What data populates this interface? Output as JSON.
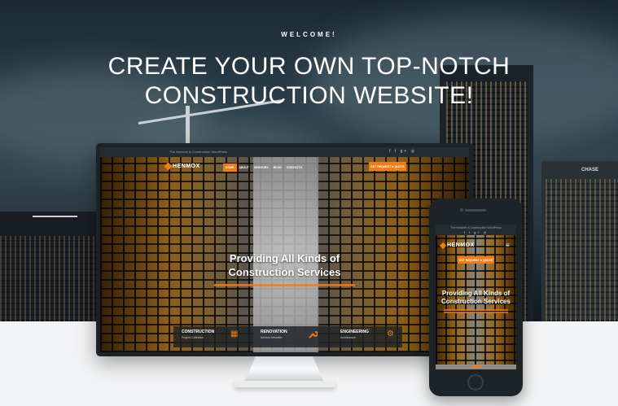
{
  "hero": {
    "welcome": "WELCOME!",
    "headline_line1": "CREATE YOUR OWN TOP-NOTCH",
    "headline_line2": "CONSTRUCTION WEBSITE!",
    "building_sign": "CHASE"
  },
  "desktop_site": {
    "tagline": "The Network is Construction WordPress",
    "social_icons": [
      "facebook-icon",
      "twitter-icon",
      "google-plus-icon",
      "instagram-icon"
    ],
    "social_glyphs": [
      "f",
      "t",
      "g+",
      "◎"
    ],
    "logo": "HENMOX",
    "nav": [
      "HOME",
      "ABOUT",
      "SERVICES",
      "BLOG",
      "CONTACTS"
    ],
    "active_nav": "HOME",
    "cta": "GET REQUEST A QUOTE",
    "hero_title_line1": "Providing All Kinds of",
    "hero_title_line2": "Construction Services",
    "services": [
      {
        "title": "CONSTRUCTION",
        "subtitle": "Project Collection",
        "icon": "building-icon",
        "glyph": "▦"
      },
      {
        "title": "RENOVATION",
        "subtitle": "Service Describe",
        "icon": "wrench-icon",
        "glyph": "🔧"
      },
      {
        "title": "ENGINEERING",
        "subtitle": "Architecture",
        "icon": "gear-icon",
        "glyph": "⚙"
      }
    ]
  },
  "mobile_site": {
    "tagline": "The Network is Construction WordPress",
    "social": "f  t  g+  ◎",
    "logo": "HENMOX",
    "menu_glyph": "≡",
    "cta": "GET REQUEST A QUOTE",
    "hero_title_line1": "Providing All Kinds of",
    "hero_title_line2": "Construction Services"
  },
  "colors": {
    "accent": "#f07c16",
    "dark": "#1d2226"
  }
}
